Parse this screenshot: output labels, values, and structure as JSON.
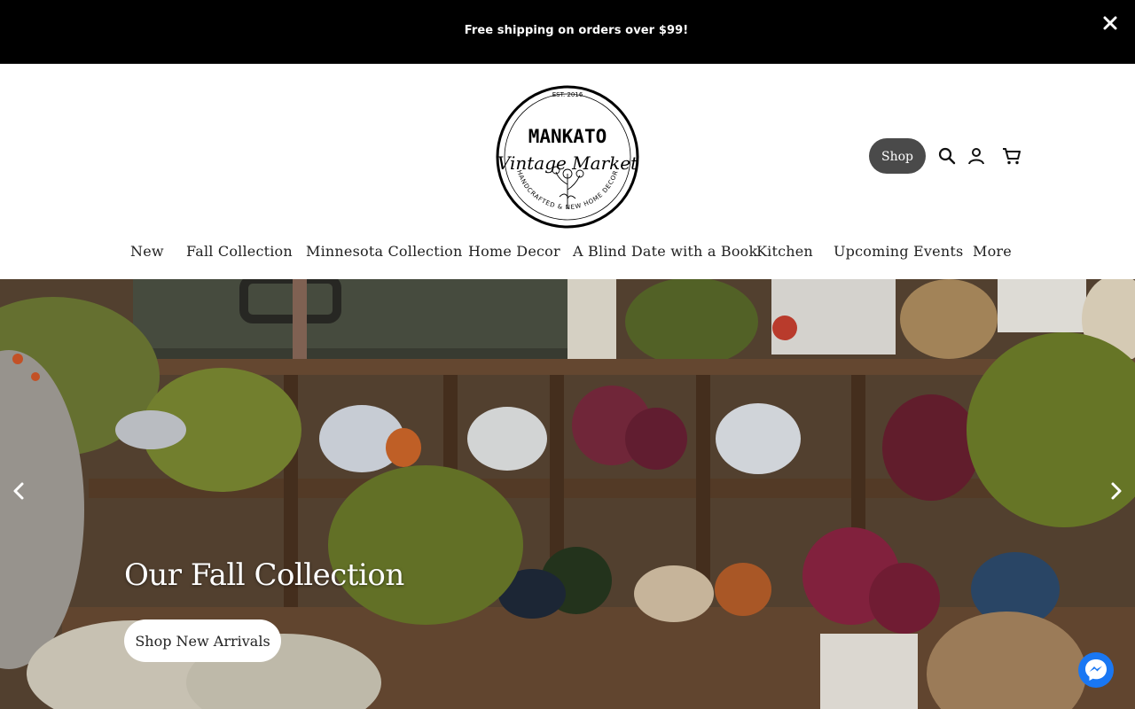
{
  "announcement": {
    "text": "Free shipping on orders over $99!"
  },
  "brand": {
    "name": "MANKATO",
    "script_text": "Vintage Market",
    "est": "EST. 2016",
    "tagline": "HANDCRAFTED & NEW HOME DECOR"
  },
  "header_actions": {
    "shop_label": "Shop",
    "icons": [
      "search-icon",
      "account-icon",
      "cart-icon"
    ]
  },
  "nav": {
    "items": [
      {
        "label": "New"
      },
      {
        "label": "Fall Collection"
      },
      {
        "label": "Minnesota Collection"
      },
      {
        "label": "Home Decor"
      },
      {
        "label": "A Blind Date with a Book"
      },
      {
        "label": "Kitchen"
      },
      {
        "label": "Upcoming Events"
      },
      {
        "label": "More"
      }
    ]
  },
  "hero": {
    "title": "Our Fall Collection",
    "cta_label": "Shop New Arrivals"
  },
  "colors": {
    "announcement_bg": "#000000",
    "shop_button_bg": "#4a4a4a",
    "messenger_blue": "#1977f3"
  }
}
